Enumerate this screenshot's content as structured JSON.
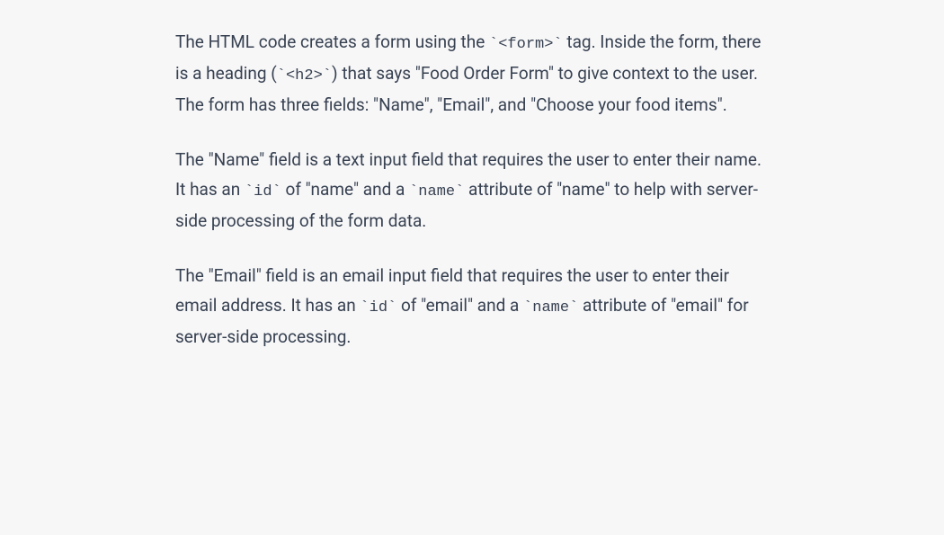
{
  "paragraphs": {
    "p1": {
      "seg1": "The HTML code creates a form using the ",
      "code1": "`<form>`",
      "seg2": " tag. Inside the form, there is a heading (",
      "code2": "`<h2>`",
      "seg3": ") that says \"Food Order Form\" to give context to the user. The form has three fields: \"Name\", \"Email\", and \"Choose your food items\"."
    },
    "p2": {
      "seg1": "The \"Name\" field is a text input field that requires the user to enter their name. It has an ",
      "code1": "`id`",
      "seg2": " of \"name\" and a ",
      "code2": "`name`",
      "seg3": " attribute of \"name\" to help with server-side processing of the form data."
    },
    "p3": {
      "seg1": "The \"Email\" field is an email input field that requires the user to enter their email address. It has an ",
      "code1": "`id`",
      "seg2": " of \"email\" and a ",
      "code2": "`name`",
      "seg3": " attribute of \"email\" for server-side processing."
    }
  }
}
